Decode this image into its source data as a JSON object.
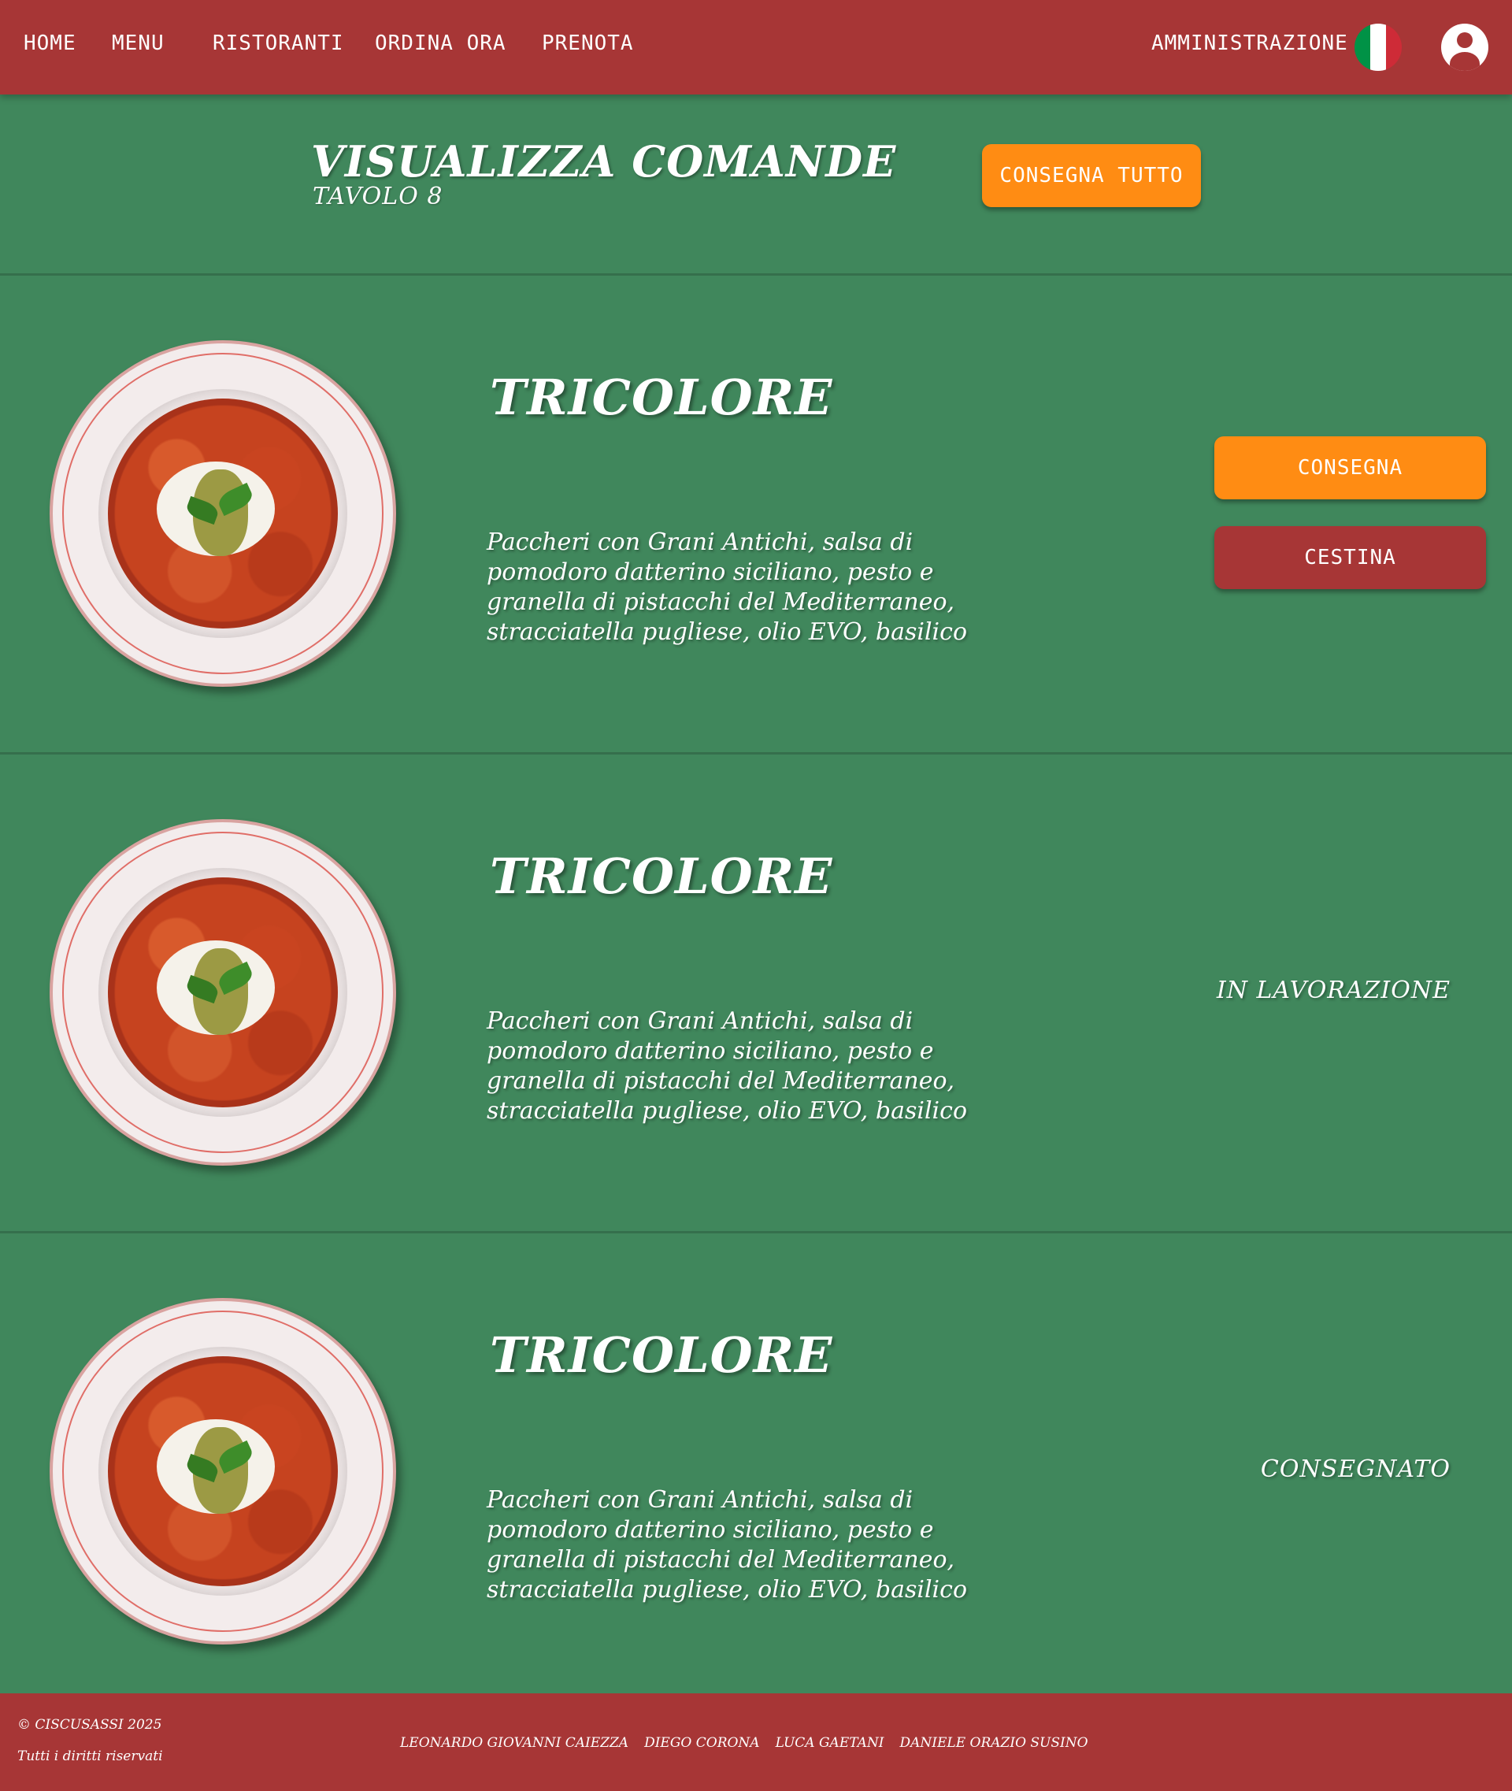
{
  "nav": {
    "home": "HOME",
    "menu": "MENU",
    "restaurants": "RISTORANTI",
    "order_now": "ORDINA ORA",
    "book": "PRENOTA",
    "admin": "AMMINISTRAZIONE",
    "language_icon": "italy-flag-icon",
    "user_icon": "user-account-icon"
  },
  "header": {
    "title": "VISUALIZZA COMANDE",
    "table": "TAVOLO 8",
    "deliver_all": "CONSEGNA TUTTO"
  },
  "orders": [
    {
      "name": "TRICOLORE",
      "description": "Paccheri con Grani Antichi, salsa di pomodoro datterino siciliano, pesto e granella di pistacchi del Mediterraneo, stracciatella pugliese, olio  EVO, basilico",
      "deliver_label": "CONSEGNA",
      "trash_label": "CESTINA"
    },
    {
      "name": "TRICOLORE",
      "description": "Paccheri con Grani Antichi, salsa di pomodoro datterino siciliano, pesto e granella di pistacchi del Mediterraneo, stracciatella pugliese, olio  EVO, basilico",
      "status": "IN LAVORAZIONE"
    },
    {
      "name": "TRICOLORE",
      "description": "Paccheri con Grani Antichi, salsa di pomodoro datterino siciliano, pesto e granella di pistacchi del Mediterraneo, stracciatella pugliese, olio  EVO, basilico",
      "status": "CONSEGNATO"
    }
  ],
  "footer": {
    "copyright": "© CISCUSASSI 2025",
    "rights": "Tutti i diritti riservati",
    "authors": [
      "LEONARDO GIOVANNI CAIEZZA",
      "DIEGO CORONA",
      "LUCA GAETANI",
      "DANIELE ORAZIO SUSINO"
    ]
  },
  "colors": {
    "background": "#40875c",
    "navbar": "#a73636",
    "accent_orange": "#ff8c13",
    "button_red": "#a73636",
    "flag_green": "#009246",
    "flag_white": "#ffffff",
    "flag_red": "#ce2b37"
  }
}
